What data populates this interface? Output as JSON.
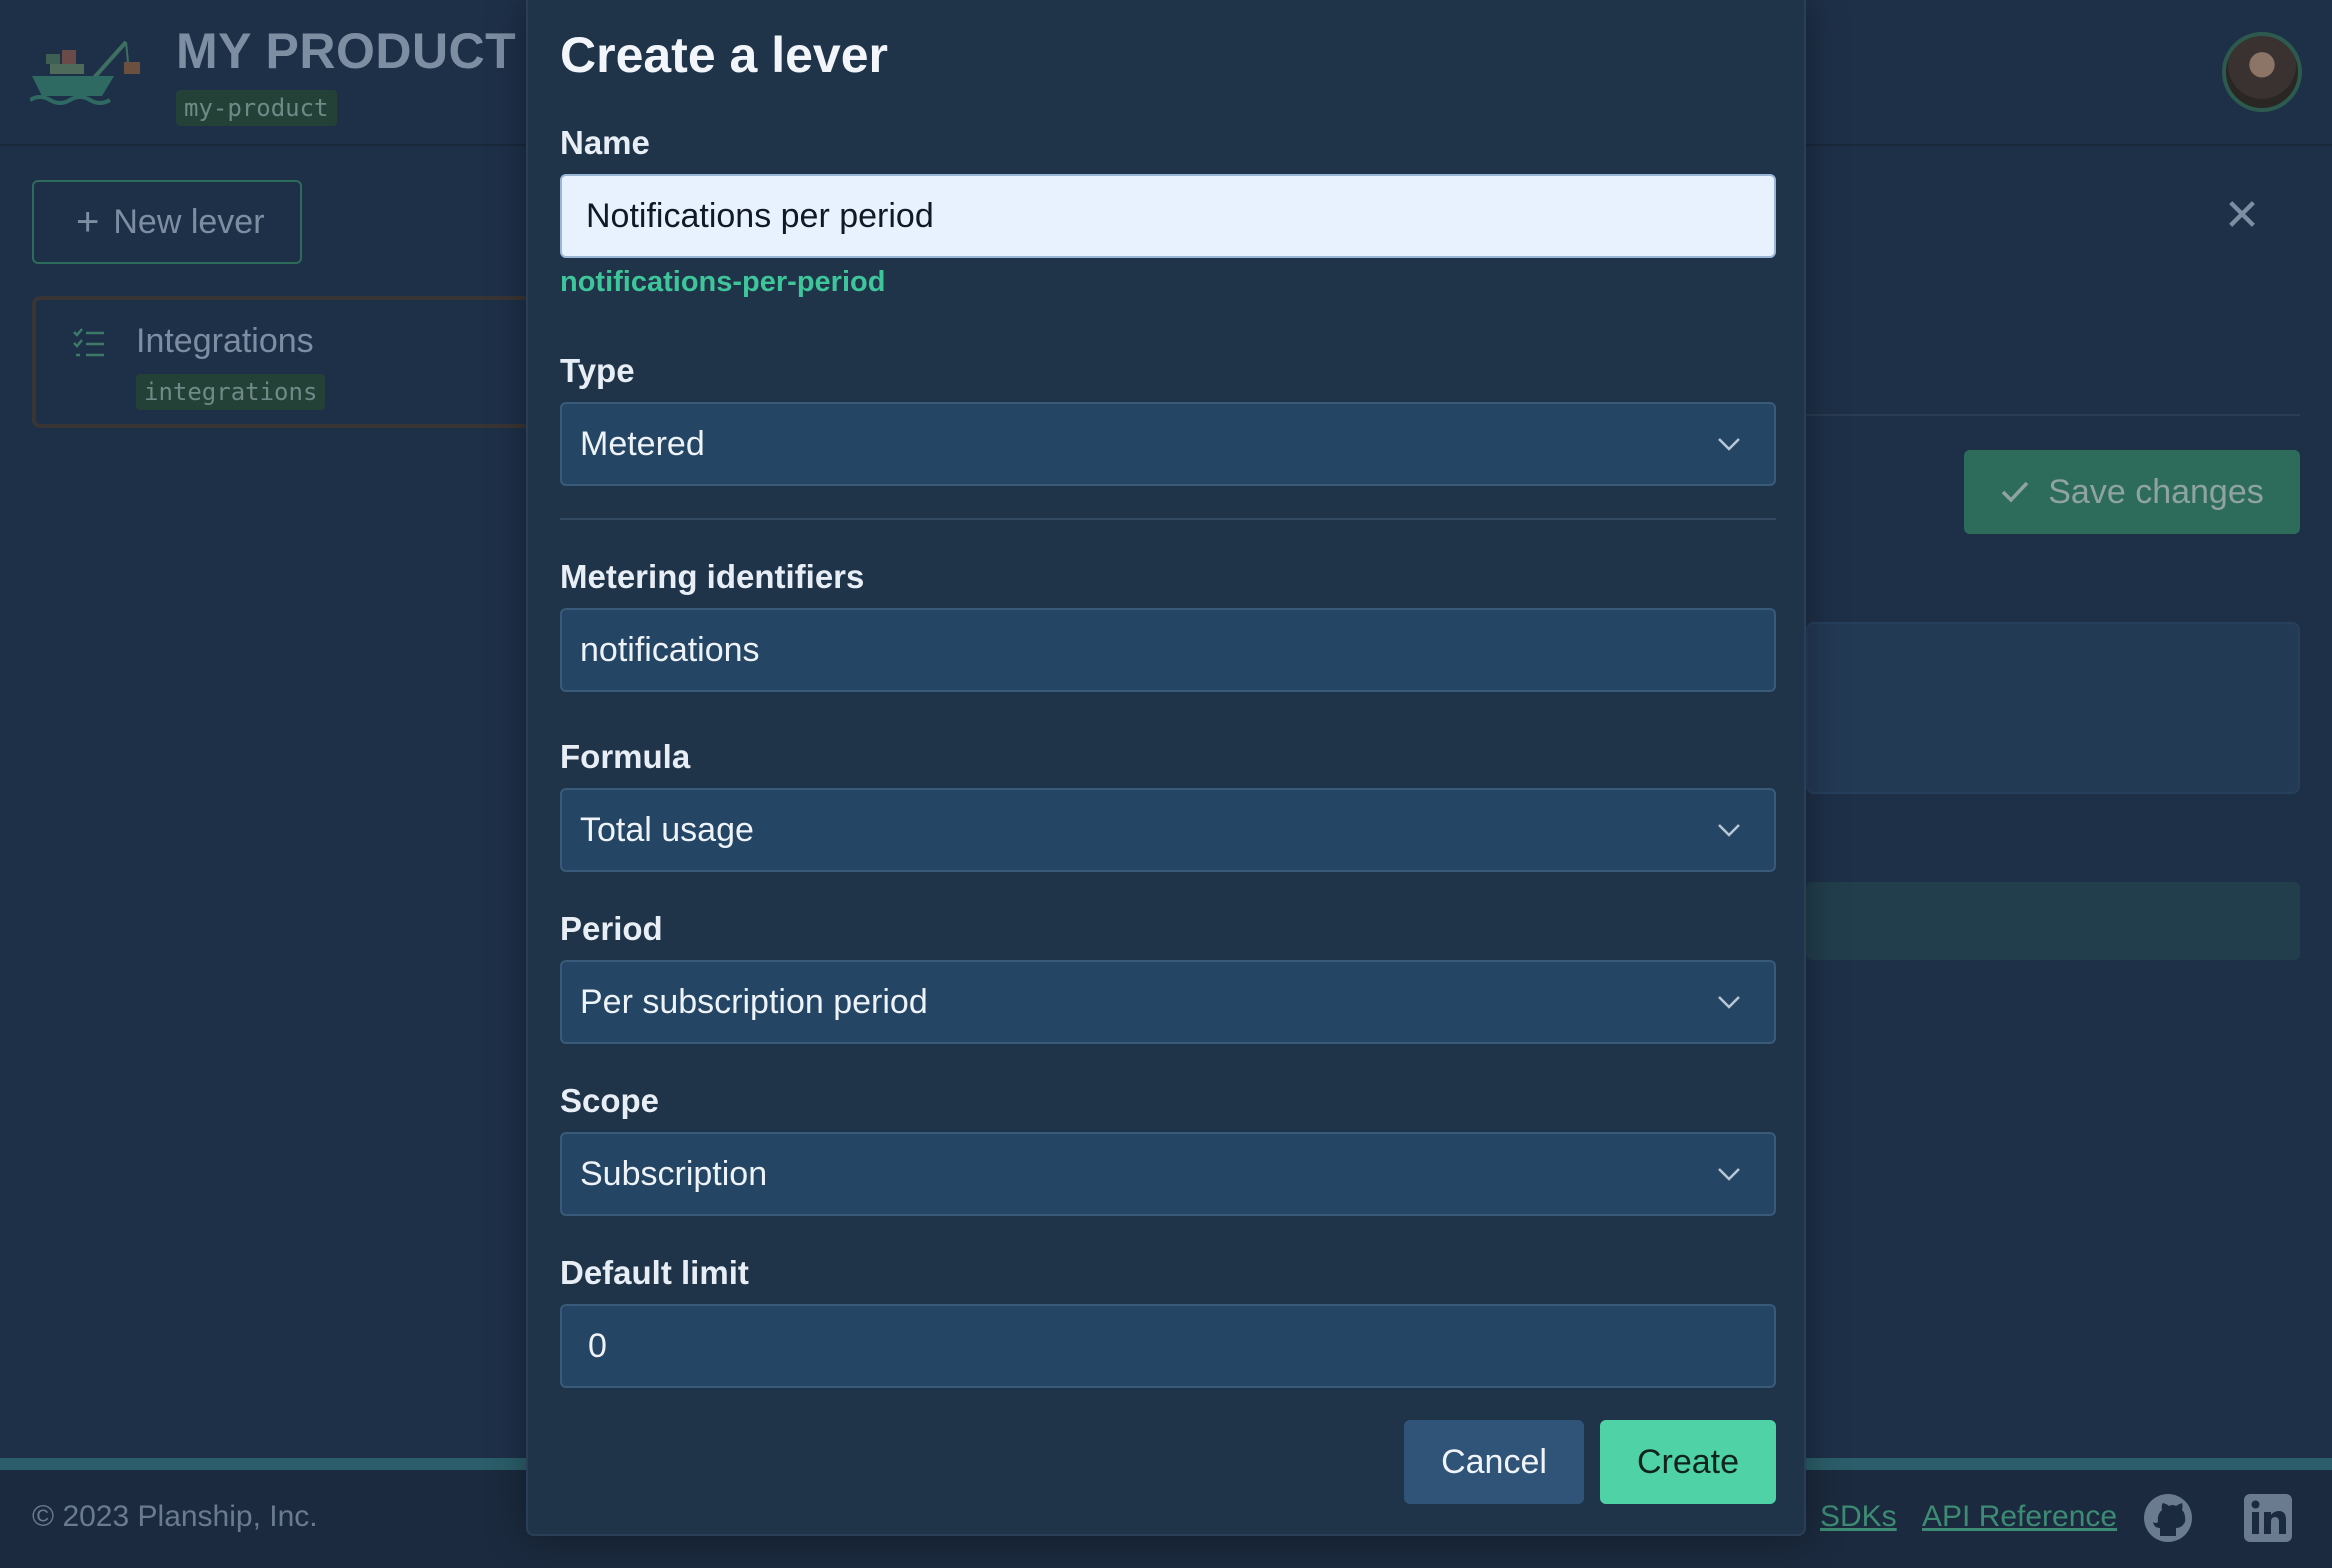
{
  "header": {
    "product_title": "MY PRODUCT",
    "product_slug": "my-product"
  },
  "sidebar": {
    "new_lever_label": "New lever",
    "levers": [
      {
        "name": "Integrations",
        "slug": "integrations"
      }
    ]
  },
  "main": {
    "save_label": "Save changes"
  },
  "modal": {
    "title": "Create a lever",
    "name_label": "Name",
    "name_value": "Notifications per period",
    "slug_hint": "notifications-per-period",
    "type_label": "Type",
    "type_value": "Metered",
    "metering_label": "Metering identifiers",
    "metering_value": "notifications",
    "formula_label": "Formula",
    "formula_value": "Total usage",
    "period_label": "Period",
    "period_value": "Per subscription period",
    "scope_label": "Scope",
    "scope_value": "Subscription",
    "default_limit_label": "Default limit",
    "default_limit_value": "0",
    "cancel_label": "Cancel",
    "create_label": "Create"
  },
  "footer": {
    "copyright": "© 2023 Planship, Inc.",
    "links": [
      "SDKs",
      "API Reference"
    ],
    "icons": [
      "github-icon",
      "linkedin-icon"
    ]
  },
  "colors": {
    "accent": "#4fd3a6",
    "background": "#1e3048",
    "modal": "#1f3349",
    "field": "#244563",
    "slug_green": "#3ec59a"
  }
}
